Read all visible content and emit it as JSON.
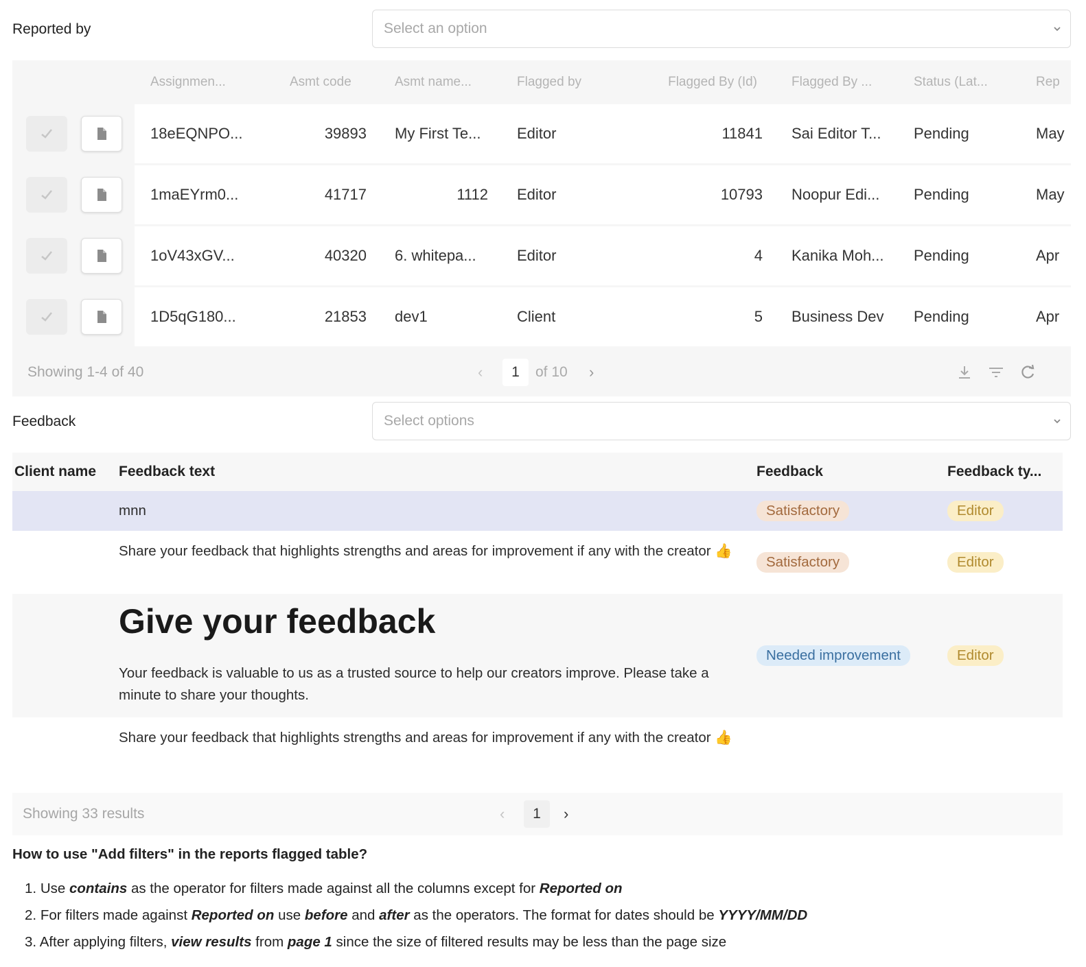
{
  "reported_by": {
    "label": "Reported by",
    "placeholder": "Select an option"
  },
  "flagged_table": {
    "columns": [
      "Assignmen...",
      "Asmt code",
      "Asmt name...",
      "Flagged by",
      "Flagged By (Id)",
      "Flagged By ...",
      "Status (Lat...",
      "Rep"
    ],
    "rows": [
      {
        "assignment": "18eEQNPO...",
        "code": "39893",
        "name": "My First Te...",
        "flagged_by": "Editor",
        "flagged_id": "11841",
        "flagged_name": "Sai Editor T...",
        "status": "Pending",
        "reported": "May"
      },
      {
        "assignment": "1maEYrm0...",
        "code": "41717",
        "name": "1112",
        "flagged_by": "Editor",
        "flagged_id": "10793",
        "flagged_name": "Noopur Edi...",
        "status": "Pending",
        "reported": "May"
      },
      {
        "assignment": "1oV43xGV...",
        "code": "40320",
        "name": "6. whitepa...",
        "flagged_by": "Editor",
        "flagged_id": "4",
        "flagged_name": "Kanika Moh...",
        "status": "Pending",
        "reported": "Apr"
      },
      {
        "assignment": "1D5qG180...",
        "code": "21853",
        "name": "dev1",
        "flagged_by": "Client",
        "flagged_id": "5",
        "flagged_name": "Business Dev",
        "status": "Pending",
        "reported": "Apr"
      }
    ],
    "footer": {
      "showing": "Showing 1-4 of 40",
      "page": "1",
      "of_pages": "of 10"
    }
  },
  "feedback_filter": {
    "label": "Feedback",
    "placeholder": "Select options"
  },
  "feedback_table": {
    "columns": [
      "Client name",
      "Feedback text",
      "Feedback",
      "Feedback ty..."
    ],
    "rows": [
      {
        "client": "",
        "text": "mnn",
        "feedback": "Satisfactory",
        "type": "Editor"
      },
      {
        "client": "",
        "text": "Share your feedback that highlights strengths and areas for improvement if any with the creator",
        "feedback": "Satisfactory",
        "type": "Editor"
      },
      {
        "client": "",
        "heading": "Give your feedback",
        "text": "Your feedback is valuable to us as a trusted source to help our creators improve. Please take a minute to share your thoughts.",
        "feedback": "Needed improvement",
        "type": "Editor"
      },
      {
        "client": "",
        "text": "Share your feedback that highlights strengths and areas for improvement if any with the creator",
        "feedback": "",
        "type": ""
      }
    ],
    "footer": {
      "showing": "Showing 33 results",
      "page": "1"
    }
  },
  "help": {
    "title": "How to use \"Add filters\" in the reports flagged table?",
    "items": [
      {
        "n": "1.",
        "parts": [
          "Use ",
          "contains",
          " as the operator for filters made against all the columns except for ",
          "Reported on",
          ""
        ]
      },
      {
        "n": "2.",
        "parts": [
          "For filters made against ",
          "Reported on",
          " use ",
          "before",
          " and ",
          "after",
          " as the operators. The format for dates should be ",
          "YYYY/MM/DD",
          ""
        ]
      },
      {
        "n": "3.",
        "parts": [
          "After applying filters, ",
          "view results",
          " from ",
          "page 1",
          " since the size of filtered results may be less than the page size"
        ]
      }
    ]
  },
  "colors": {
    "row_highlight": "#e3e5f4",
    "pill_satisfactory": "#f6e4d6",
    "pill_needed": "#dcebf8",
    "pill_editor": "#fbeec7"
  },
  "icons": [
    "check-icon",
    "document-icon",
    "chevron-down-icon",
    "chevron-left-icon",
    "chevron-right-icon",
    "download-icon",
    "filter-icon",
    "refresh-icon",
    "thumbs-up-icon"
  ]
}
